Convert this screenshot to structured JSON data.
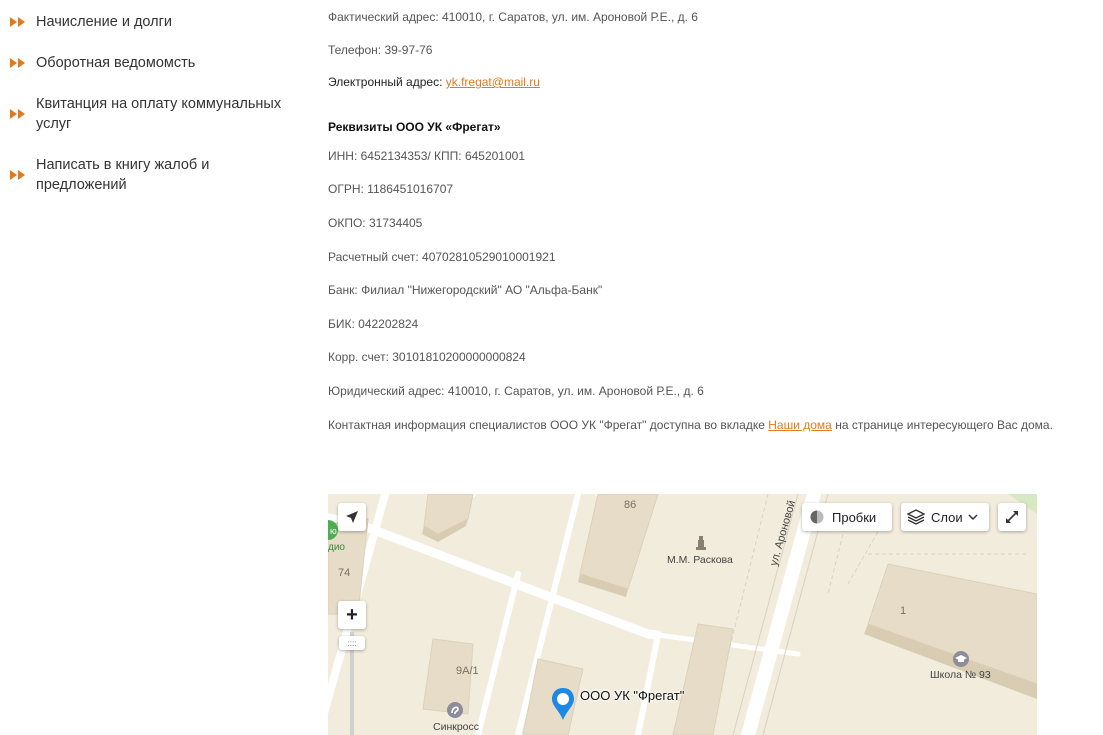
{
  "sidebar": {
    "items": [
      {
        "label": "Начисление и долги"
      },
      {
        "label": "Оборотная ведомомсть"
      },
      {
        "label_line1": "Квитанция на оплату коммунальных",
        "label_line2": "услуг"
      },
      {
        "label": "Написать в книгу жалоб и предложений"
      }
    ]
  },
  "contacts": {
    "actual_address": "Фактический адрес: 410010, г. Саратов, ул. им. Ароновой Р.Е., д. 6",
    "phone": "Телефон: 39-97-76",
    "email_label": "Электронный адрес: ",
    "email": "yk.fregat@mail.ru"
  },
  "requisites": {
    "heading": "Реквизиты ООО УК «Фрегат»",
    "inn": "ИНН: 6452134353/ КПП: 645201001",
    "ogrn": "ОГРН: 1186451016707",
    "okpo": "ОКПО: 31734405",
    "account": "Расчетный счет: 40702810529010001921",
    "bank": "Банк: Филиал \"Нижегородский\" АО \"Альфа-Банк\"",
    "bik": "БИК: 042202824",
    "corr": "Корр. счет: 30101810200000000824",
    "legal_address": "Юридический адрес: 410010, г. Саратов, ул. им. Ароновой Р.Е., д. 6",
    "contact_info_prefix": "Контактная информация специалистов ООО УК \"Фрегат\" доступна во вкладке ",
    "contact_info_link": "Наши дома",
    "contact_info_suffix": " на странице интересующего Вас дома."
  },
  "map": {
    "traffic_label": "Пробки",
    "layers_label": "Слои",
    "zoom_in": "+",
    "zoom_handle": "::::",
    "street_label": "ул. Ароновой",
    "labels": {
      "n86": "86",
      "n74": "74",
      "n1": "1",
      "n9a1": "9А/1",
      "raskova": "М.М. Раскова",
      "school": "Школа № 93",
      "sinkross": "Синкросс",
      "radio": "дио"
    },
    "marker_label": "ООО УК \"Фрегат\"",
    "icons": [
      "location-arrow-icon",
      "traffic-icon",
      "layers-icon",
      "chevron-down-icon",
      "expand-icon",
      "plus-icon",
      "map-pin-icon",
      "monument-icon",
      "school-icon",
      "shop-icon"
    ],
    "colors": {
      "accent": "#e07a1f",
      "pin": "#1e88e5",
      "building": "#e6dcc8",
      "road": "#ffffff"
    }
  }
}
